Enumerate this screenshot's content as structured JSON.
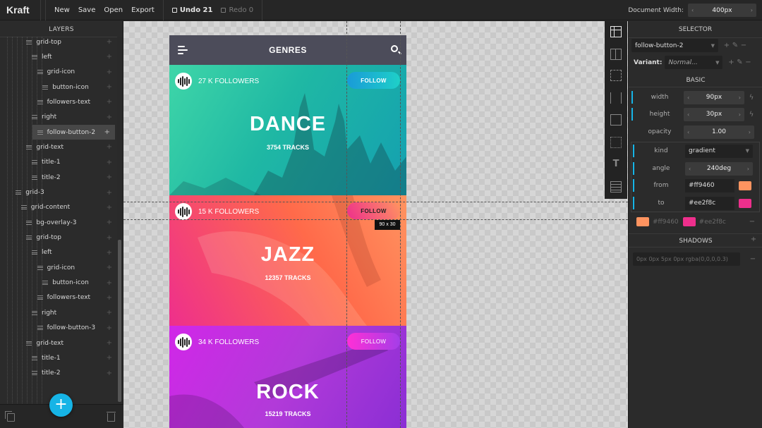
{
  "topbar": {
    "app_name": "Kraft",
    "new_label": "New",
    "save_label": "Save",
    "open_label": "Open",
    "export_label": "Export",
    "undo_label": "Undo 21",
    "redo_label": "Redo 0",
    "doc_width_label": "Document Width:",
    "doc_width_value": "400px"
  },
  "layers": {
    "title": "LAYERS",
    "items": [
      {
        "label": "grid-top",
        "depth": 4
      },
      {
        "label": "left",
        "depth": 5
      },
      {
        "label": "grid-icon",
        "depth": 6
      },
      {
        "label": "button-icon",
        "depth": 7
      },
      {
        "label": "followers-text",
        "depth": 6
      },
      {
        "label": "right",
        "depth": 5
      },
      {
        "label": "follow-button-2",
        "depth": 6,
        "selected": true
      },
      {
        "label": "grid-text",
        "depth": 4
      },
      {
        "label": "title-1",
        "depth": 5
      },
      {
        "label": "title-2",
        "depth": 5
      },
      {
        "label": "grid-3",
        "depth": 2
      },
      {
        "label": "grid-content",
        "depth": 3
      },
      {
        "label": "bg-overlay-3",
        "depth": 4
      },
      {
        "label": "grid-top",
        "depth": 4
      },
      {
        "label": "left",
        "depth": 5
      },
      {
        "label": "grid-icon",
        "depth": 6
      },
      {
        "label": "button-icon",
        "depth": 7
      },
      {
        "label": "followers-text",
        "depth": 6
      },
      {
        "label": "right",
        "depth": 5
      },
      {
        "label": "follow-button-3",
        "depth": 6
      },
      {
        "label": "grid-text",
        "depth": 4
      },
      {
        "label": "title-1",
        "depth": 5
      },
      {
        "label": "title-2",
        "depth": 5
      }
    ]
  },
  "phone": {
    "title": "GENRES",
    "cards": [
      {
        "followers": "27 K FOLLOWERS",
        "follow": "FOLLOW",
        "title": "DANCE",
        "tracks": "3754 TRACKS",
        "bg_from": "#1ab5a0",
        "bg_to": "#3fd6b4",
        "btn_from": "#1ec8c8",
        "btn_to": "#1a9bd8"
      },
      {
        "followers": "15 K FOLLOWERS",
        "follow": "FOLLOW",
        "title": "JAZZ",
        "tracks": "12357 TRACKS",
        "bg_from": "#ee2f8c",
        "bg_to": "#ff9460",
        "btn_from": "#ff9460",
        "btn_to": "#ee2f8c"
      },
      {
        "followers": "34 K FOLLOWERS",
        "follow": "FOLLOW",
        "title": "ROCK",
        "tracks": "15219 TRACKS",
        "bg_from": "#c51fe8",
        "bg_to": "#7a2fd0",
        "btn_from": "#ff2fd6",
        "btn_to": "#9a3bea"
      }
    ],
    "size_tip": "90 x 30"
  },
  "selector": {
    "title": "SELECTOR",
    "value": "follow-button-2",
    "variant_label": "Variant:",
    "variant_value": "Normal..."
  },
  "basic": {
    "title": "BASIC",
    "width_label": "width",
    "width_value": "90px",
    "height_label": "height",
    "height_value": "30px",
    "opacity_label": "opacity",
    "opacity_value": "1.00",
    "kind_label": "kind",
    "kind_value": "gradient",
    "angle_label": "angle",
    "angle_value": "240deg",
    "from_label": "from",
    "from_value": "#ff9460",
    "to_label": "to",
    "to_value": "#ee2f8c",
    "stop1": "#ff9460",
    "stop2": "#ee2f8c"
  },
  "shadows": {
    "title": "SHADOWS",
    "value": "0px 0px 5px 0px rgba(0,0,0,0.3)"
  },
  "colors": {
    "accent": "#16b4e6",
    "from": "#ff9460",
    "to": "#ee2f8c"
  }
}
